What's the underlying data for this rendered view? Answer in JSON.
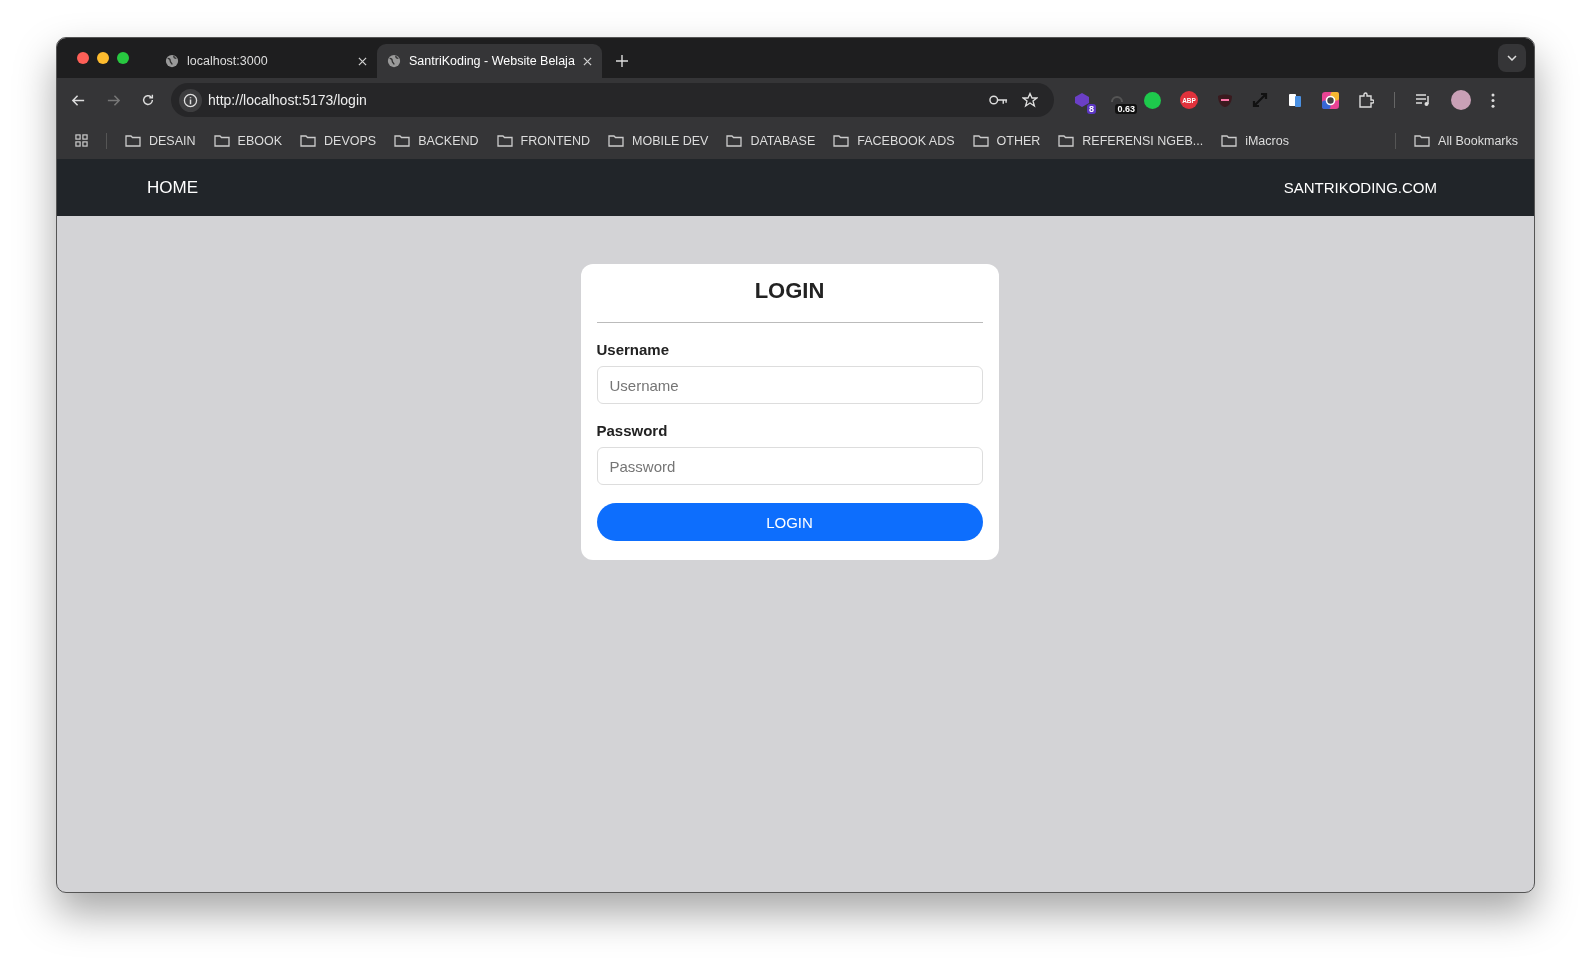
{
  "tabs": [
    {
      "title": "localhost:3000",
      "selected": false
    },
    {
      "title": "SantriKoding - Website Belaja",
      "selected": true
    }
  ],
  "address": "http://localhost:5173/login",
  "extensions": [
    {
      "kind": "cube",
      "badge": "8"
    },
    {
      "kind": "meter",
      "badge": "0.63"
    },
    {
      "kind": "dot"
    },
    {
      "kind": "abp",
      "label": "ABP"
    },
    {
      "kind": "mask"
    },
    {
      "kind": "expand"
    },
    {
      "kind": "docs"
    },
    {
      "kind": "ring"
    },
    {
      "kind": "puzzle"
    }
  ],
  "bookmarks": [
    "DESAIN",
    "EBOOK",
    "DEVOPS",
    "BACKEND",
    "FRONTEND",
    "MOBILE DEV",
    "DATABASE",
    "FACEBOOK ADS",
    "OTHER",
    "REFERENSI NGEB...",
    "iMacros"
  ],
  "all_bookmarks": "All Bookmarks",
  "navbar": {
    "home": "HOME",
    "brand": "SANTRIKODING.COM"
  },
  "form": {
    "title": "LOGIN",
    "fields": [
      {
        "label": "Username",
        "placeholder": "Username"
      },
      {
        "label": "Password",
        "placeholder": "Password"
      }
    ],
    "button": "LOGIN"
  }
}
